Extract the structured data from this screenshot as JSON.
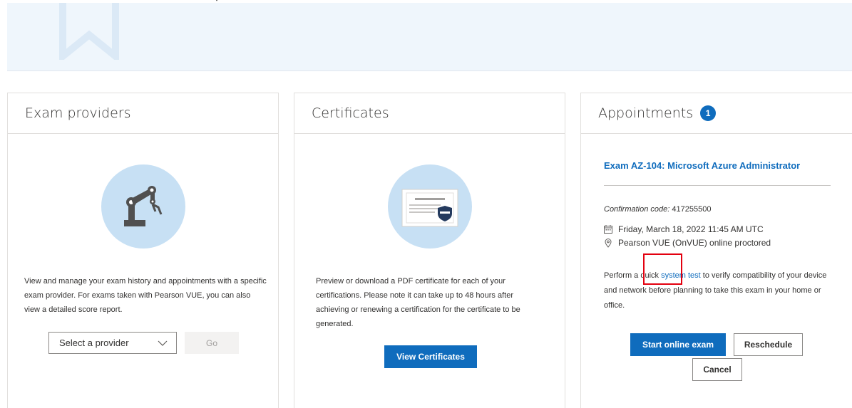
{
  "exam_providers": {
    "title": "Exam providers",
    "description": "View and manage your exam history and appointments with a specific exam provider. For exams taken with Pearson VUE, you can also view a detailed score report.",
    "select_placeholder": "Select a provider",
    "go_label": "Go"
  },
  "certificates": {
    "title": "Certificates",
    "description": "Preview or download a PDF certificate for each of your certifications. Please note it can take up to 48 hours after achieving or renewing a certification for the certificate to be generated.",
    "button_label": "View Certificates"
  },
  "appointments": {
    "title": "Appointments",
    "count": "1",
    "exam_title": "Exam AZ-104: Microsoft Azure Administrator",
    "confirmation_label": "Confirmation code:",
    "confirmation_code": "417255500",
    "date_time": "Friday, March 18, 2022 11:45 AM UTC",
    "location": "Pearson VUE (OnVUE) online proctored",
    "desc_before": "Perform a quick ",
    "desc_link": "system test",
    "desc_after": " to verify compatibility of your device and network before planning to take this exam in your home or office.",
    "start_label": "Start online exam",
    "reschedule_label": "Reschedule",
    "cancel_label": "Cancel"
  },
  "icons": {
    "banner": "bookmark-icon",
    "providers": "robot-arm-icon",
    "certificates": "certificate-icon",
    "calendar": "calendar-icon",
    "location": "location-pin-icon",
    "dropdown": "chevron-down-icon"
  },
  "colors": {
    "accent": "#0f6cbd",
    "banner_bg": "#eff6fc",
    "illustration_bg": "#c7e0f4",
    "highlight": "#e3000f"
  }
}
